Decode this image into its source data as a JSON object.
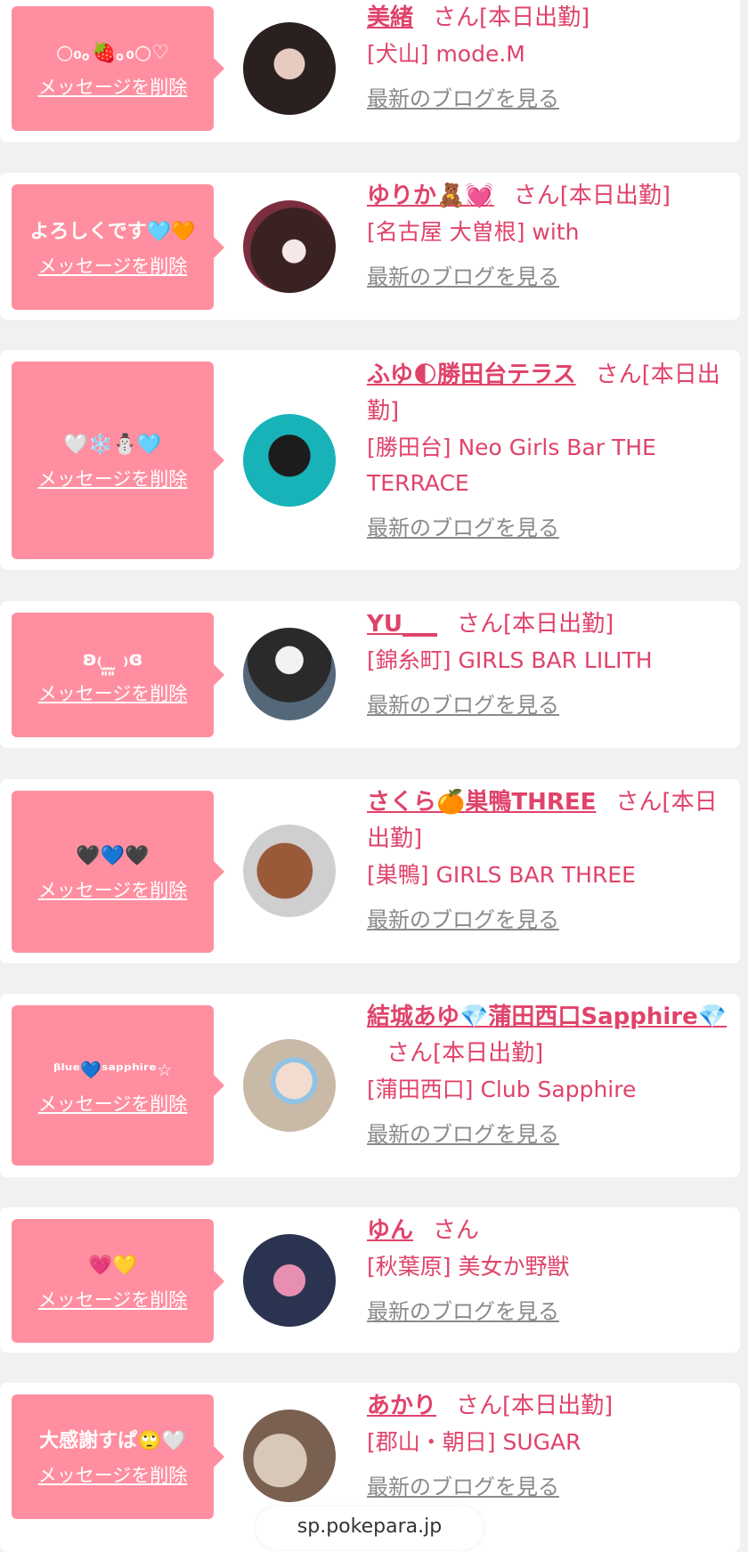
{
  "common": {
    "delete_label": "メッセージを削除",
    "blog_label": "最新のブログを見る"
  },
  "items": [
    {
      "message": "○₀｡🍓｡₀○♡",
      "name": "美緒",
      "suffix": "さん[本日出勤]",
      "shop": "[犬山] mode.M"
    },
    {
      "message": "よろしくです🩵🧡",
      "name": "ゆりか🧸💓",
      "suffix": "さん[本日出勤]",
      "shop": "[名古屋 大曽根] with"
    },
    {
      "message": "🤍❄️⛄🩵",
      "name": "ふゆ🌓勝田台テラス",
      "suffix": "さん[本日出勤]",
      "shop": "[勝田台] Neo Girls Bar THE TERRACE"
    },
    {
      "message": "ʚ₍ ̫͈ ̫͈ ₎ɞ",
      "name": "YU___",
      "suffix": "さん[本日出勤]",
      "shop": "[錦糸町] GIRLS BAR LILITH"
    },
    {
      "message": "🖤💙🖤",
      "name": "さくら🍊巣鴨THREE",
      "suffix": "さん[本日出勤]",
      "shop": "[巣鴨] GIRLS BAR THREE"
    },
    {
      "message": "ᵝˡᵘᵉ💙ˢᵃᵖᵖʰⁱʳᵉ☆",
      "name": "結城あゆ💎蒲田西口Sapphire💎",
      "suffix": "さん[本日出勤]",
      "shop": "[蒲田西口] Club Sapphire"
    },
    {
      "message": "💗💛",
      "name": "ゆん",
      "suffix": "さん",
      "shop": "[秋葉原] 美女か野獣"
    },
    {
      "message": "大感謝すぱ🙄🤍",
      "name": "あかり",
      "suffix": "さん[本日出勤]",
      "shop": "[郡山・朝日] SUGAR"
    }
  ],
  "footer": {
    "domain": "sp.pokepara.jp"
  },
  "colors": {
    "accent": "#e0436a",
    "bubble": "#ff8fa0",
    "background": "#f1f1f1"
  }
}
